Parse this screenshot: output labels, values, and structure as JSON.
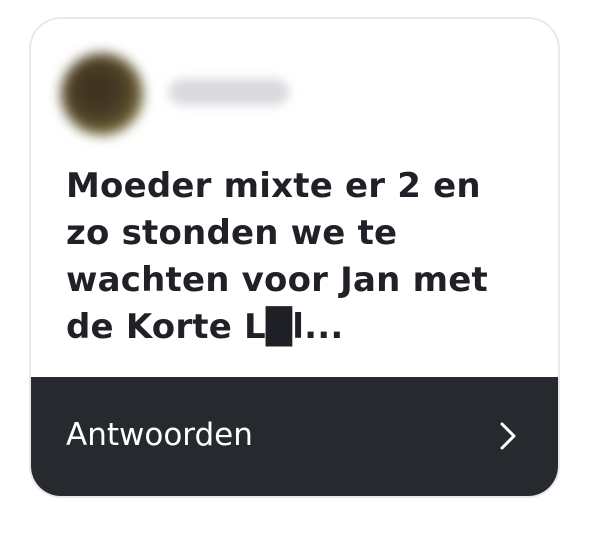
{
  "notification": {
    "sender_name": "",
    "message": "Moeder mixte er 2 en zo stonden we te wachten voor Jan met de Korte L█l...",
    "reply_label": "Antwoorden",
    "icons": {
      "avatar": "avatar-image",
      "chevron": "chevron-right-icon"
    }
  },
  "colors": {
    "reply_bar": "#26292e",
    "message_text": "#1f2126",
    "reply_text": "#ffffff"
  }
}
